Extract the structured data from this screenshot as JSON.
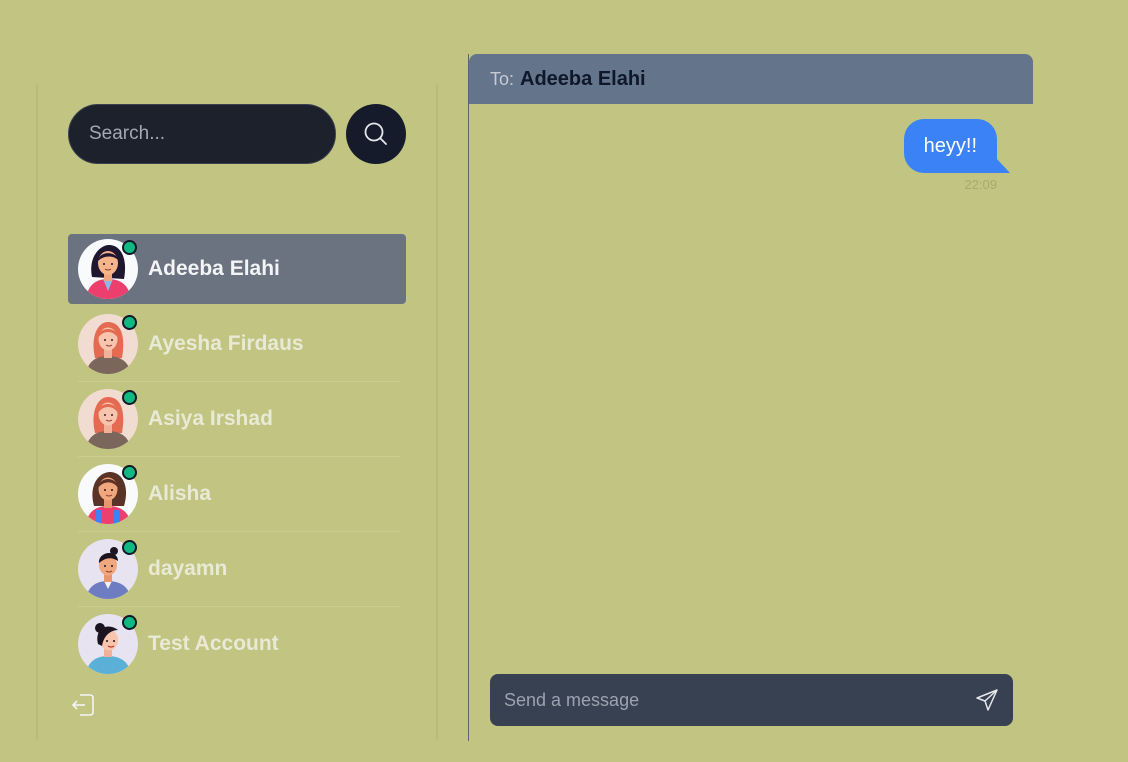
{
  "search": {
    "placeholder": "Search..."
  },
  "contacts": [
    {
      "name": "Adeeba Elahi",
      "online": true,
      "active": true
    },
    {
      "name": "Ayesha Firdaus",
      "online": true,
      "active": false
    },
    {
      "name": "Asiya Irshad",
      "online": true,
      "active": false
    },
    {
      "name": "Alisha",
      "online": true,
      "active": false
    },
    {
      "name": "dayamn",
      "online": true,
      "active": false
    },
    {
      "name": "Test Account",
      "online": true,
      "active": false
    }
  ],
  "chat": {
    "to_label": "To:",
    "to_name": "Adeeba Elahi",
    "messages": [
      {
        "text": "heyy!!",
        "time": "22:09",
        "sent": true
      }
    ]
  },
  "composer": {
    "placeholder": "Send a message"
  },
  "colors": {
    "background": "#c2c482",
    "active_contact": "#6b7280",
    "online": "#10b981",
    "bubble": "#3b82f6",
    "header": "#64748b"
  },
  "icons": {
    "search": "search-icon",
    "logout": "logout-icon",
    "send": "send-icon"
  }
}
